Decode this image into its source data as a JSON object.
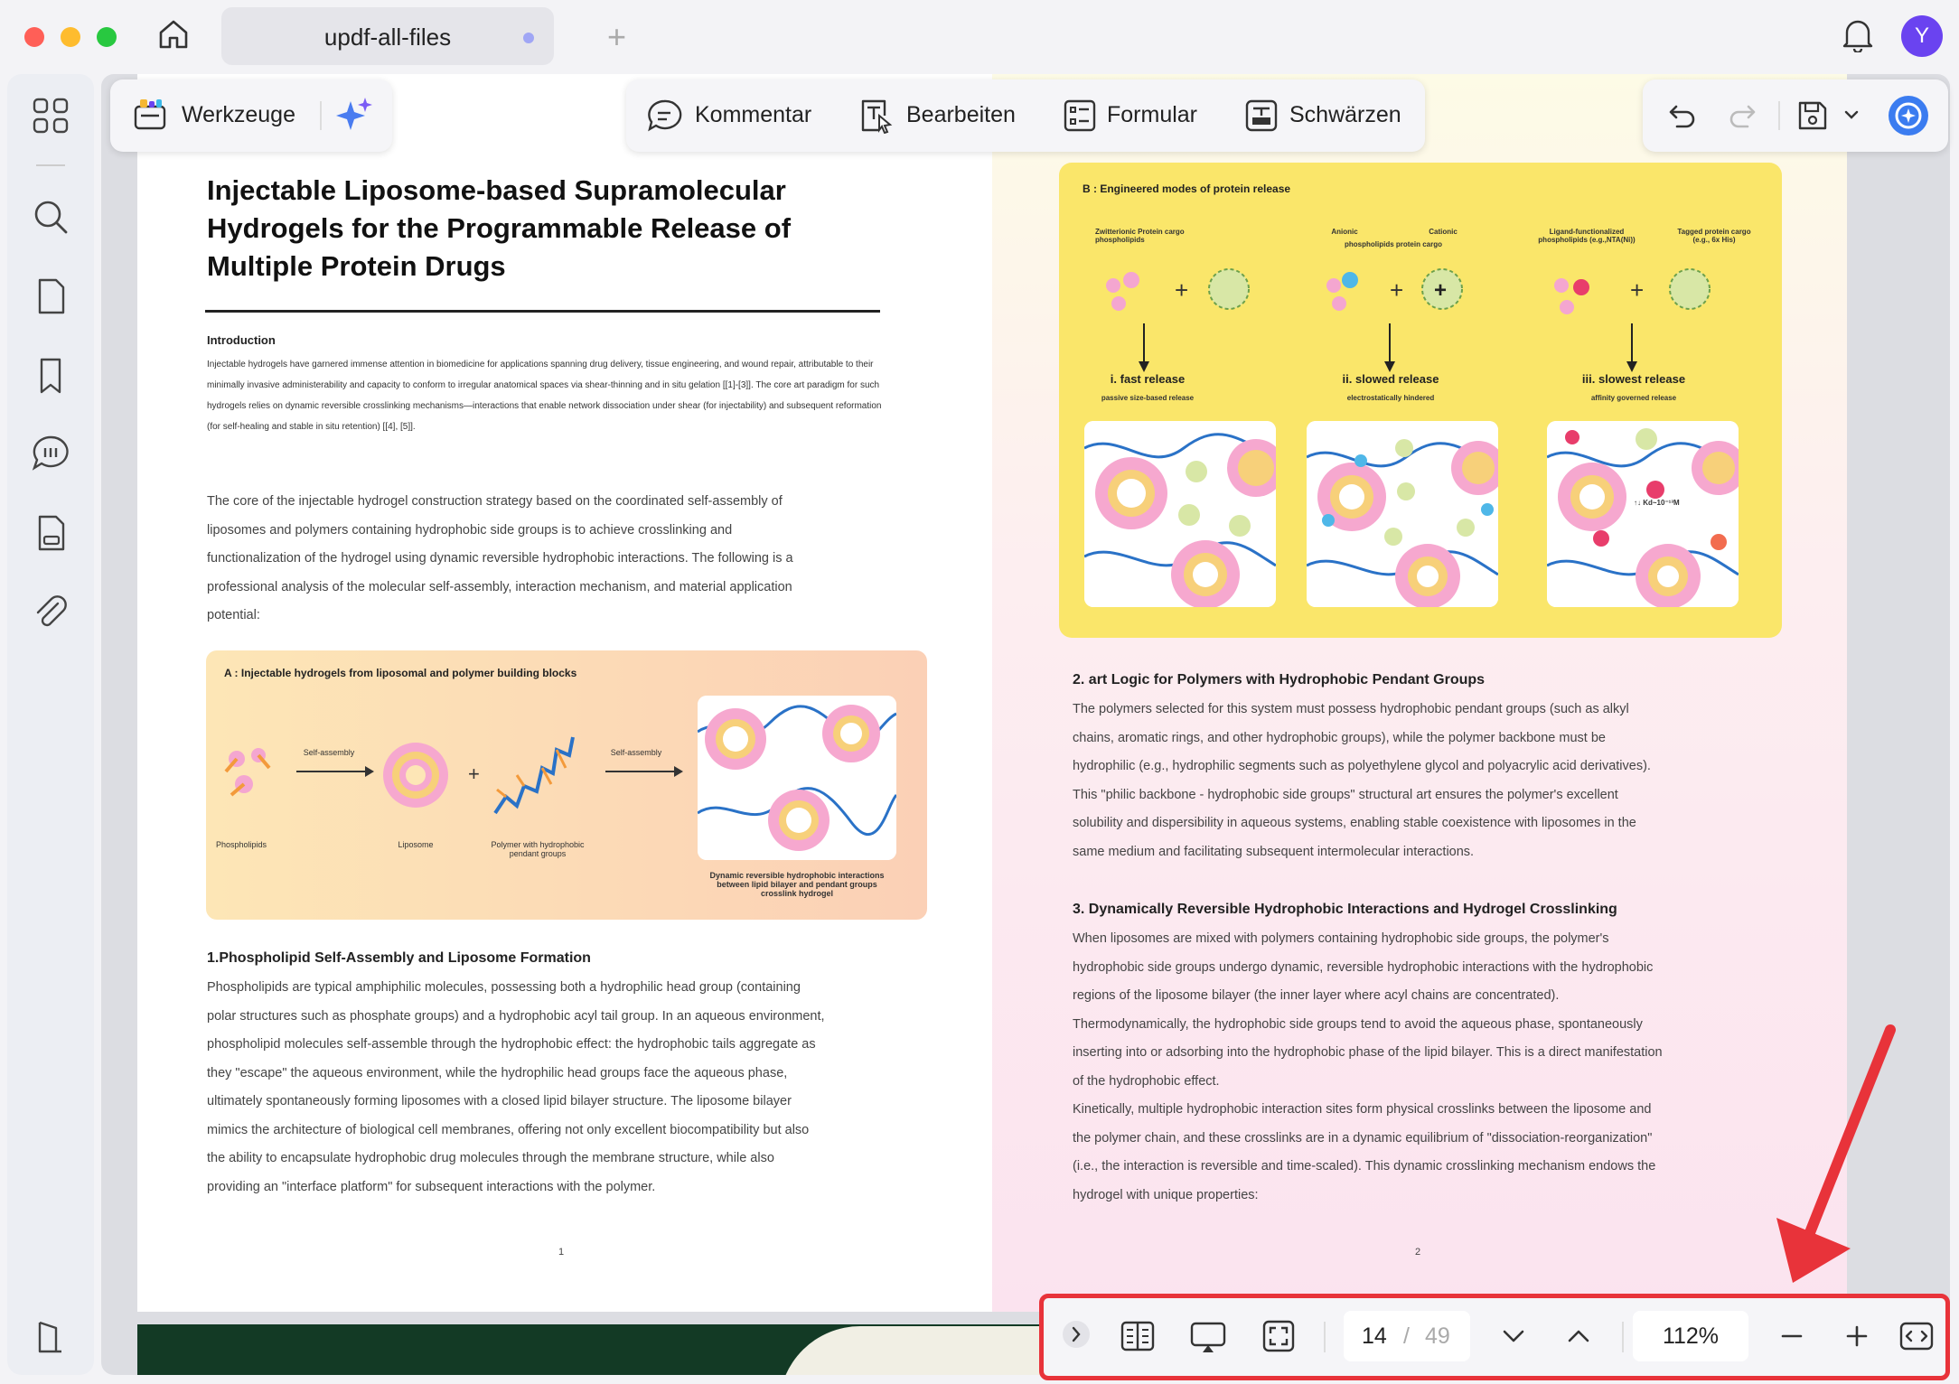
{
  "window": {
    "tab_title": "updf-all-files",
    "avatar_letter": "Y"
  },
  "toolbar": {
    "tools_label": "Werkzeuge",
    "comment_label": "Kommentar",
    "edit_label": "Bearbeiten",
    "form_label": "Formular",
    "redact_label": "Schwärzen"
  },
  "page_nav": {
    "current_page": "14",
    "separator": "/",
    "total_pages": "49",
    "zoom": "112%"
  },
  "left_page": {
    "title_line1": "Injectable Liposome-based Supramolecular",
    "title_line2": "Hydrogels for the Programmable Release of",
    "title_line3": "Multiple Protein Drugs",
    "intro_heading": "Introduction",
    "intro_lines": [
      "Injectable hydrogels have garnered immense attention in biomedicine for applications spanning drug delivery, tissue engineering, and wound repair, attributable to their",
      "minimally invasive administerability and capacity to conform to irregular anatomical spaces via shear-thinning and in situ gelation [[1]-[3]]. The core art paradigm for such",
      "hydrogels relies on dynamic reversible crosslinking mechanisms—interactions that enable network dissociation under shear (for injectability) and subsequent reformation",
      "(for self-healing and stable in situ retention) [[4], [5]]."
    ],
    "core_lines": [
      "The core of the injectable hydrogel construction strategy based on the coordinated self-assembly of",
      "liposomes and polymers containing hydrophobic side groups is to achieve crosslinking and",
      "functionalization of the hydrogel using dynamic reversible hydrophobic interactions. The following is a",
      "professional analysis of the molecular self-assembly, interaction mechanism, and material application",
      "potential:"
    ],
    "figA": {
      "title": "A : Injectable hydrogels from liposomal and polymer building blocks",
      "arrow1": "Self-assembly",
      "arrow2": "Self-assembly",
      "phospholipids": "Phospholipids",
      "liposome": "Liposome",
      "polymer_line1": "Polymer with hydrophobic",
      "polymer_line2": "pendant groups",
      "caption_line1": "Dynamic reversible hydrophobic interactions",
      "caption_line2": "between lipid bilayer and pendant groups",
      "caption_line3": "crosslink hydrogel"
    },
    "section1_heading": "1.Phospholipid Self-Assembly and Liposome Formation",
    "section1_lines": [
      "Phospholipids are typical amphiphilic molecules, possessing both a hydrophilic head group (containing",
      "polar structures such as phosphate groups) and a hydrophobic acyl tail group. In an aqueous environment,",
      "phospholipid molecules self-assemble through the hydrophobic effect: the hydrophobic tails aggregate as",
      "they \"escape\" the aqueous environment, while the hydrophilic head groups face the aqueous phase,",
      "ultimately spontaneously forming liposomes with a closed lipid bilayer structure. The liposome bilayer",
      "mimics the architecture of biological cell membranes, offering not only excellent biocompatibility but also",
      "the ability to encapsulate hydrophobic drug molecules through the membrane structure, while also",
      "providing an \"interface platform\" for subsequent interactions with the polymer."
    ],
    "page_number": "1"
  },
  "right_page": {
    "figB": {
      "title": "B : Engineered modes of protein release",
      "col1_line1": "Zwitterionic Protein cargo",
      "col1_line2": "phospholipids",
      "col2_a": "Anionic",
      "col2_b": "Cationic",
      "col2_line2": "phospholipids protein cargo",
      "col3_a": "Ligand-functionalized",
      "col3_a2": "phospholipids (e.g.,NTA(Ni))",
      "col3_b": "Tagged protein cargo",
      "col3_b2": "(e.g., 6x His)",
      "mode1": "i. fast release",
      "mode1_sub": "passive size-based release",
      "mode2": "ii. slowed release",
      "mode2_sub": "electrostatically hindered",
      "mode3": "iii. slowest release",
      "mode3_sub": "affinity governed release",
      "kd": "↑↓ Kd~10⁻¹³M"
    },
    "section2_heading": "2. art Logic for Polymers with Hydrophobic Pendant Groups",
    "section2_lines": [
      "The polymers selected for this system must possess hydrophobic pendant groups (such as alkyl",
      "chains, aromatic rings, and other hydrophobic groups), while the polymer backbone must be",
      "hydrophilic (e.g., hydrophilic segments such as polyethylene glycol and polyacrylic acid derivatives).",
      "This \"philic backbone - hydrophobic side groups\" structural art ensures the polymer's excellent",
      "solubility and dispersibility in aqueous systems, enabling stable coexistence with liposomes in the",
      "same medium and facilitating subsequent intermolecular interactions."
    ],
    "section3_heading": "3. Dynamically Reversible Hydrophobic Interactions and Hydrogel Crosslinking",
    "section3_lines": [
      "When liposomes are mixed with polymers containing hydrophobic side groups, the polymer's",
      "hydrophobic side groups undergo dynamic, reversible hydrophobic interactions with the hydrophobic",
      "regions of the liposome bilayer (the inner layer where acyl chains are concentrated).",
      "Thermodynamically, the hydrophobic side groups tend to avoid the aqueous phase, spontaneously",
      "inserting into or adsorbing into the hydrophobic phase of the lipid bilayer. This is a direct manifestation",
      "of the hydrophobic effect.",
      "Kinetically, multiple hydrophobic interaction sites form physical crosslinks between the liposome and",
      "the polymer chain, and these crosslinks are in a dynamic equilibrium of \"dissociation-reorganization\"",
      "(i.e., the interaction is reversible and time-scaled). This dynamic crosslinking mechanism endows the",
      "hydrogel with unique properties:"
    ],
    "page_number": "2"
  },
  "colors": {
    "highlight": "#e8333a",
    "accent": "#6a43f0",
    "figB_bg": "#fae66a"
  }
}
